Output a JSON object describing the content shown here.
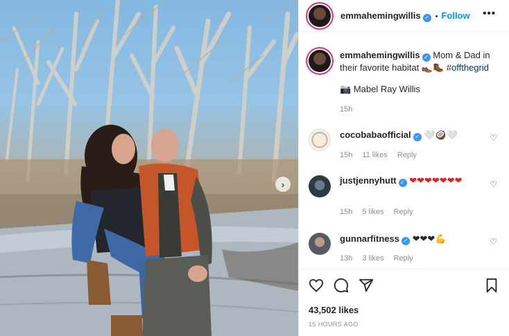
{
  "post": {
    "author": "emmahemingwillis",
    "follow_label": "Follow",
    "dot": "•",
    "more": "•••",
    "caption_user": "emmahemingwillis",
    "caption_text": "Mom & Dad in their favorite habitat 👞🥾 ",
    "caption_hashtag": "#offthegrid",
    "tagged_icon": "📷",
    "tagged_name": "Mabel Ray Willis",
    "caption_time": "15h",
    "likes": "43,502 likes",
    "posted_ago": "15 HOURS AGO"
  },
  "comments": [
    {
      "user": "cocobabaofficial",
      "text": "🤍🥥🤍",
      "time": "15h",
      "likes": "11 likes",
      "reply": "Reply"
    },
    {
      "user": "justjennyhutt",
      "text": "❤❤❤❤❤❤❤",
      "time": "15h",
      "likes": "5 likes",
      "reply": "Reply"
    },
    {
      "user": "gunnarfitness",
      "text": "❤❤❤💪",
      "time": "13h",
      "likes": "3 likes",
      "reply": "Reply"
    }
  ],
  "icons": {
    "verified": "✓",
    "next": "›"
  },
  "colors": {
    "follow": "#0095f6",
    "verified": "#3897f0",
    "hashtag": "#00376b",
    "heart": "#ed1c24"
  }
}
